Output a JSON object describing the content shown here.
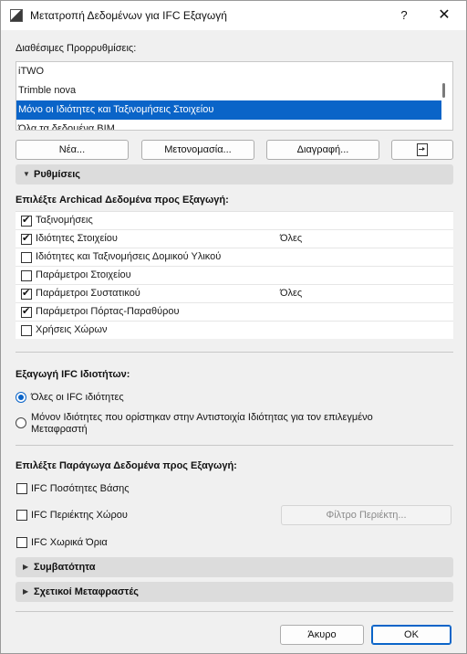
{
  "window": {
    "title": "Μετατροπή Δεδομένων για IFC Εξαγωγή",
    "help_label": "?",
    "close_label": "✕"
  },
  "presets": {
    "label": "Διαθέσιμες Προρρυθμίσεις:",
    "items": [
      {
        "label": "iTWO",
        "selected": false
      },
      {
        "label": "Trimble nova",
        "selected": false
      },
      {
        "label": "Μόνο οι Ιδιότητες και Ταξινομήσεις Στοιχείου",
        "selected": true
      },
      {
        "label": "Όλα τα δεδομένα BIM",
        "selected": false
      }
    ],
    "buttons": {
      "new": "Νέα...",
      "rename": "Μετονομασία...",
      "delete": "Διαγραφή..."
    }
  },
  "settings": {
    "header": "Ρυθμίσεις",
    "data_label": "Επιλέξτε Archicad Δεδομένα προς Εξαγωγή:",
    "items": [
      {
        "label": "Ταξινομήσεις",
        "checked": true,
        "value": ""
      },
      {
        "label": "Ιδιότητες Στοιχείου",
        "checked": true,
        "value": "Όλες"
      },
      {
        "label": "Ιδιότητες και Ταξινομήσεις Δομικού Υλικού",
        "checked": false,
        "value": ""
      },
      {
        "label": "Παράμετροι Στοιχείου",
        "checked": false,
        "value": ""
      },
      {
        "label": "Παράμετροι Συστατικού",
        "checked": true,
        "value": "Όλες"
      },
      {
        "label": "Παράμετροι Πόρτας-Παραθύρου",
        "checked": true,
        "value": ""
      },
      {
        "label": "Χρήσεις Χώρων",
        "checked": false,
        "value": ""
      }
    ]
  },
  "ifc_properties": {
    "label": "Εξαγωγή IFC Ιδιοτήτων:",
    "options": [
      {
        "label": "Όλες οι IFC ιδιότητες",
        "selected": true
      },
      {
        "label": "Μόνον Ιδιότητες που ορίστηκαν στην Αντιστοιχία Ιδιότητας για τον επιλεγμένο Μεταφραστή",
        "selected": false
      }
    ]
  },
  "derived": {
    "label": "Επιλέξτε Παράγωγα Δεδομένα προς Εξαγωγή:",
    "items": [
      {
        "label": "IFC Ποσότητες Βάσης",
        "checked": false
      },
      {
        "label": "IFC Περιέκτης Χώρου",
        "checked": false
      },
      {
        "label": "IFC Χωρικά Όρια",
        "checked": false
      }
    ],
    "filter_button": "Φίλτρο Περιέκτη..."
  },
  "sections": {
    "compatibility": "Συμβατότητα",
    "related_translators": "Σχετικοί Μεταφραστές"
  },
  "footer": {
    "cancel": "Άκυρο",
    "ok": "OK"
  },
  "colors": {
    "accent": "#0a64c8",
    "section_header": "#dcdcdc",
    "window_bg": "#f0f0f0"
  }
}
